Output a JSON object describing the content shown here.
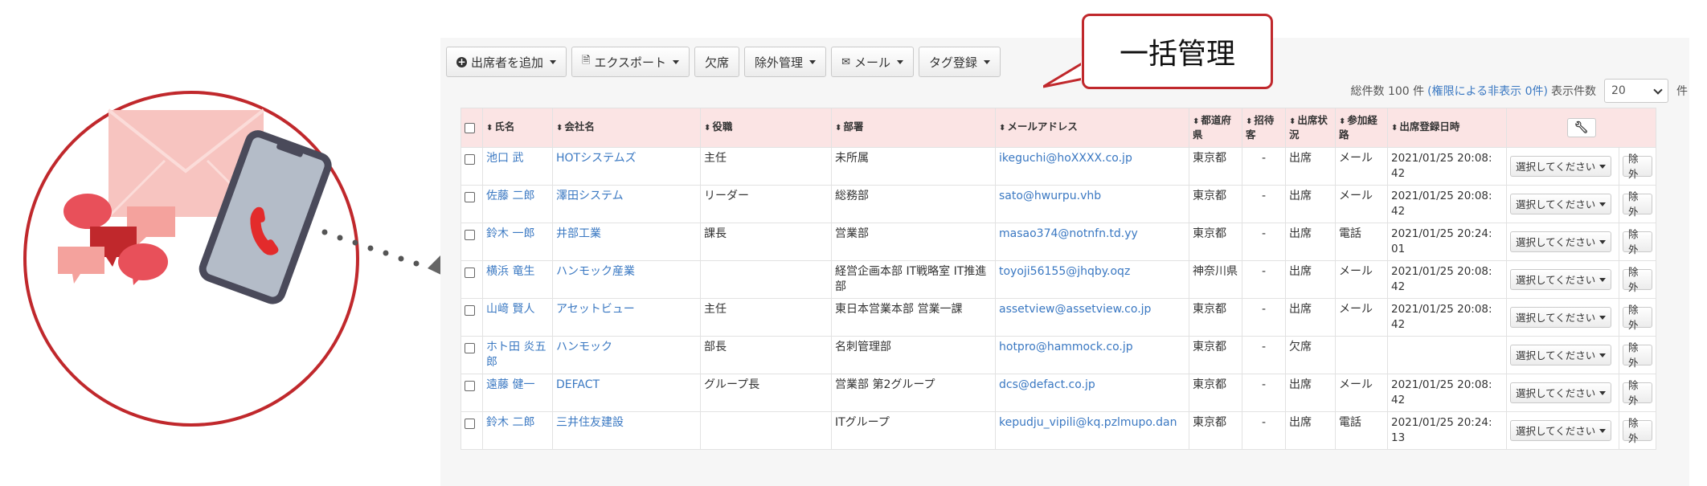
{
  "callout": {
    "text": "一括管理"
  },
  "toolbar": {
    "add_attendee": "出席者を追加",
    "export": "エクスポート",
    "absent": "欠席",
    "exclusion": "除外管理",
    "mail": "メール",
    "tag": "タグ登録"
  },
  "summary": {
    "total_prefix": "総件数 100 件",
    "hidden": "(権限による非表示 0件)",
    "per_page_label": "表示件数",
    "per_page_value": "20",
    "unit": "件"
  },
  "table": {
    "headers": [
      "氏名",
      "会社名",
      "役職",
      "部署",
      "メールアドレス",
      "都道府県",
      "招待客",
      "出席状況",
      "参加経路",
      "出席登録日時"
    ],
    "select_label": "選択してください",
    "remove_label": "除外",
    "rows": [
      {
        "name": "池口 武",
        "company": "HOTシステムズ",
        "title": "主任",
        "dept": "未所属",
        "email": "ikeguchi@hoXXXX.co.jp",
        "pref": "東京都",
        "invite": "-",
        "status": "出席",
        "route": "メール",
        "date": "2021/01/25 20:08:",
        "date2": "42"
      },
      {
        "name": "佐藤 二郎",
        "company": "澤田システム",
        "title": "リーダー",
        "dept": "総務部",
        "email": "sato@hwurpu.vhb",
        "pref": "東京都",
        "invite": "-",
        "status": "出席",
        "route": "メール",
        "date": "2021/01/25 20:08:",
        "date2": "42"
      },
      {
        "name": "鈴木 一郎",
        "company": "井部工業",
        "title": "課長",
        "dept": "営業部",
        "email": "masao374@notnfn.td.yy",
        "pref": "東京都",
        "invite": "-",
        "status": "出席",
        "route": "電話",
        "date": "2021/01/25 20:24:",
        "date2": "01"
      },
      {
        "name": "横浜 竜生",
        "company": "ハンモック産業",
        "title": "",
        "dept": "経営企画本部 IT戦略室 IT推進部",
        "email": "toyoji56155@jhqby.oqz",
        "pref": "神奈川県",
        "invite": "-",
        "status": "出席",
        "route": "メール",
        "date": "2021/01/25 20:08:",
        "date2": "42"
      },
      {
        "name": "山﨑 賢人",
        "company": "アセットビュー",
        "title": "主任",
        "dept": "東日本営業本部 営業一課",
        "email": "assetview@assetview.co.jp",
        "pref": "東京都",
        "invite": "-",
        "status": "出席",
        "route": "メール",
        "date": "2021/01/25 20:08:",
        "date2": "42"
      },
      {
        "name": "ホト田 炎五郎",
        "company": "ハンモック",
        "title": "部長",
        "dept": "名刺管理部",
        "email": "hotpro@hammock.co.jp",
        "pref": "東京都",
        "invite": "-",
        "status": "欠席",
        "route": "",
        "date": "",
        "date2": ""
      },
      {
        "name": "遠藤 健一",
        "company": "DEFACT",
        "title": "グループ長",
        "dept": "営業部 第2グループ",
        "email": "dcs@defact.co.jp",
        "pref": "東京都",
        "invite": "-",
        "status": "出席",
        "route": "メール",
        "date": "2021/01/25 20:08:",
        "date2": "42"
      },
      {
        "name": "鈴木 二郎",
        "company": "三井住友建設",
        "title": "",
        "dept": "ITグループ",
        "email": "kepudju_vipili@kq.pzlmupo.dan",
        "pref": "東京都",
        "invite": "-",
        "status": "出席",
        "route": "電話",
        "date": "2021/01/25 20:24:",
        "date2": "13"
      }
    ]
  }
}
